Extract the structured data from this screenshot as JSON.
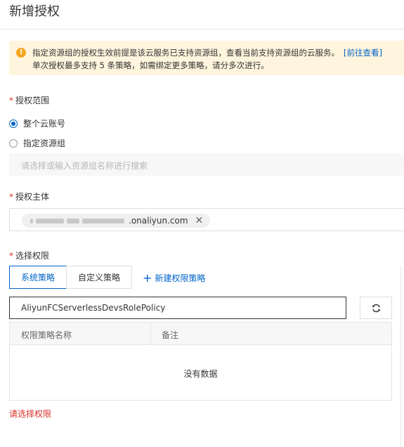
{
  "page": {
    "title": "新增授权"
  },
  "notice": {
    "line1": "指定资源组的授权生效前提是该云服务已支持资源组，查看当前支持资源组的云服务。",
    "link": "[前往查看]",
    "line2": "单次授权最多支持 5 条策略，如需绑定更多策略，请分多次进行。",
    "icon": "warning-icon",
    "color": "#fff4dd"
  },
  "scope": {
    "label": "授权范围",
    "required_mark": "*",
    "options": [
      {
        "label": "整个云账号",
        "selected": true
      },
      {
        "label": "指定资源组",
        "selected": false
      }
    ],
    "resource_group_placeholder": "请选择或输入资源组名称进行搜索"
  },
  "principal": {
    "label": "授权主体",
    "required_mark": "*",
    "tag_suffix": ".onaliyun.com",
    "remove_icon": "close-icon"
  },
  "permissions": {
    "label": "选择权限",
    "required_mark": "*",
    "tabs": [
      {
        "label": "系统策略",
        "active": true
      },
      {
        "label": "自定义策略",
        "active": false
      }
    ],
    "new_policy_label": "新建权限策略",
    "search_value": "AliyunFCServerlessDevsRolePolicy",
    "refresh_icon": "refresh-icon",
    "table": {
      "columns": [
        "权限策略名称",
        "备注"
      ],
      "rows": [],
      "empty_text": "没有数据"
    },
    "error_text": "请选择权限"
  },
  "colors": {
    "primary": "#0064c8",
    "error": "#d93026",
    "warning": "#f5a623"
  }
}
